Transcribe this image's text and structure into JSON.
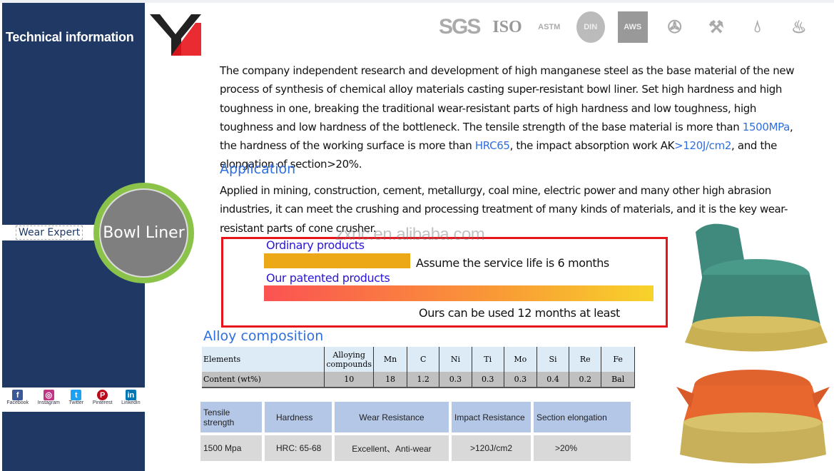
{
  "sidebar": {
    "title": "Technical information",
    "tagline": "Wear Expert",
    "product": "Bowl Liner",
    "social": [
      {
        "label": "Facebook",
        "glyph": "f",
        "color": "#3b5998"
      },
      {
        "label": "Instagram",
        "glyph": "◎",
        "color": "#c13584"
      },
      {
        "label": "Twitter",
        "glyph": "t",
        "color": "#1da1f2"
      },
      {
        "label": "Pinterest",
        "glyph": "P",
        "color": "#bd081c"
      },
      {
        "label": "LinkedIn",
        "glyph": "in",
        "color": "#0077b5"
      }
    ]
  },
  "certs": [
    "SGS",
    "ISO",
    "ASTM",
    "DIN",
    "AWS",
    "cutting-icon",
    "hammer-icon",
    "water-drop-icon",
    "flame-icon"
  ],
  "intro": {
    "p1": "The company independent research and development of high manganese steel as the base material of the new process of synthesis of chemical alloy materials casting super-resistant bowl liner. Set high hardness and high toughness in one, breaking the traditional wear-resistant parts of high hardness and low toughness, high toughness and low hardness of the bottleneck. The tensile strength of the base material is more than ",
    "v1": "1500MPa",
    "p2": ", the hardness of the working surface is more than ",
    "v2": "HRC65",
    "p3": ", the impact absorption work AK",
    "v3": ">120J/cm2",
    "p4": ", and the elongation of section>20%."
  },
  "application": {
    "heading": "Application",
    "text": "Applied in mining, construction, cement, metallurgy, coal mine, electric power and many other high abrasion industries, it can meet the crushing and processing treatment of many kinds of materials, and it is the key wear-resistant parts of cone crusher."
  },
  "watermark": "zxnc.en.alibaba.com",
  "comparison": {
    "ordinary_label": "Ordinary products",
    "ordinary_text": "Assume the service life is 6 months",
    "ordinary_months": 6,
    "patented_label": "Our patented products",
    "patented_text": "Ours can be used 12 months at least",
    "patented_months": 12
  },
  "alloy": {
    "heading": "Alloy composition",
    "headers": [
      "Elements",
      "Alloying compounds",
      "Mn",
      "C",
      "Ni",
      "Ti",
      "Mo",
      "Si",
      "Re",
      "Fe"
    ],
    "values": [
      "Content (wt%)",
      "10",
      "18",
      "1.2",
      "0.3",
      "0.3",
      "0.3",
      "0.4",
      "0.2",
      "Bal"
    ]
  },
  "properties": {
    "headers": [
      "Tensile strength",
      "Hardness",
      "Wear Resistance",
      "Impact Resistance",
      "Section elongation"
    ],
    "values": [
      "1500 Mpa",
      "HRC: 65-68",
      "Excellent、Anti-wear",
      ">120J/cm2",
      ">20%"
    ]
  }
}
